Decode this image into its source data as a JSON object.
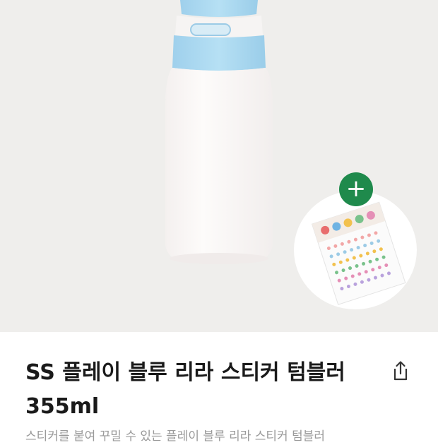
{
  "product": {
    "image_name": "tumbler-product-image",
    "title": "SS 플레이 블루 리라 스티커 텀블러 355ml",
    "description_preview": "스티커를 붙여 꾸밀 수 있는 플레이 블루 리라 스티커 텀블러"
  },
  "addon": {
    "plus_label": "+"
  },
  "icons": {
    "share": "share-icon",
    "plus": "plus-icon"
  },
  "colors": {
    "lid_blue": "#a8d8f0",
    "body_white": "#fbf8f7",
    "plus_green": "#1f8a4c",
    "background": "#efeeec"
  }
}
